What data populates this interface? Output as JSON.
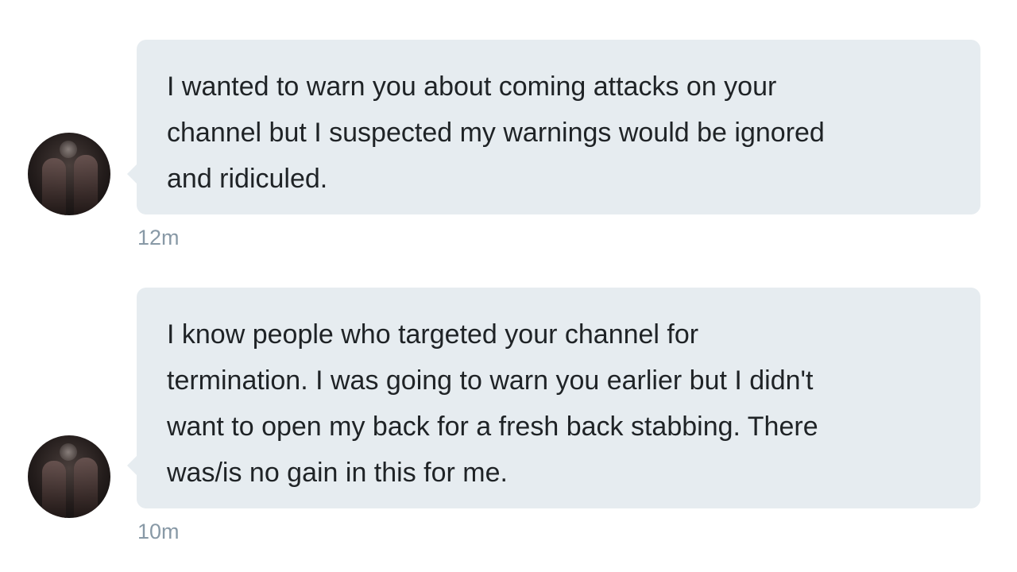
{
  "messages": [
    {
      "text": "I wanted to warn you about coming attacks on your\nchannel but I suspected my warnings would be ignored\nand ridiculed.",
      "time": "12m"
    },
    {
      "text": "I know people who targeted your channel for\ntermination.  I was going to warn you earlier but I didn't\nwant to open my back for a fresh back stabbing. There\nwas/is no gain in this for me.",
      "time": "10m"
    }
  ],
  "colors": {
    "bubble_background": "#e6ecf0",
    "message_text": "#1f2326",
    "timestamp_text": "#8899a6",
    "page_background": "#ffffff"
  }
}
